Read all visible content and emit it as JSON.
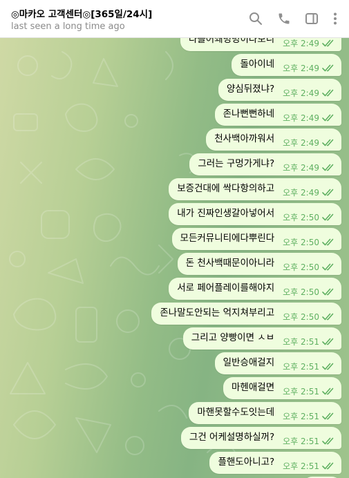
{
  "header": {
    "title": "◎마카오 고객센터◎[365일/24시]",
    "status": "last seen a long time ago"
  },
  "icons": {
    "search": "search-icon",
    "call": "phone-icon",
    "sidebar": "sidebar-toggle-icon",
    "menu": "more-vertical-icon",
    "read": "double-check-icon"
  },
  "colors": {
    "bubble_outgoing": "#effdde",
    "time_text": "#5fb061",
    "check": "#5fb061",
    "wallpaper_light": "#cfd9a5",
    "wallpaper_dark": "#86b483"
  },
  "messages": [
    {
      "text": "다들어쇄병병이다보니",
      "time": "오후 2:49"
    },
    {
      "text": "돌아이네",
      "time": "오후 2:49"
    },
    {
      "text": "양심뒤졌냐?",
      "time": "오후 2:49"
    },
    {
      "text": "존나뻔뻔하네",
      "time": "오후 2:49"
    },
    {
      "text": "천사백아까워서",
      "time": "오후 2:49"
    },
    {
      "text": "그러는 구멍가게냐?",
      "time": "오후 2:49"
    },
    {
      "text": "보증건대에 싹다항의하고",
      "time": "오후 2:49"
    },
    {
      "text": "내가 진짜인생갈아넣어서",
      "time": "오후 2:50"
    },
    {
      "text": "모든커뮤니티에다뿌린다",
      "time": "오후 2:50"
    },
    {
      "text": "돈 천사백때문이아니라",
      "time": "오후 2:50"
    },
    {
      "text": "서로 페어플레이를해야지",
      "time": "오후 2:50"
    },
    {
      "text": "존나말도안되는 억지쳐부리고",
      "time": "오후 2:50"
    },
    {
      "text": "그리고 양빵이면 ㅅㅂ",
      "time": "오후 2:51"
    },
    {
      "text": "일반승애걸지",
      "time": "오후 2:51"
    },
    {
      "text": "마헨애걸면",
      "time": "오후 2:51"
    },
    {
      "text": "마핸못할수도잇는데",
      "time": "오후 2:51"
    },
    {
      "text": "그건 어케설명하실꺼?",
      "time": "오후 2:51"
    },
    {
      "text": "플핸도아니고?",
      "time": "오후 2:51"
    },
    {
      "text": "",
      "time": ""
    }
  ]
}
